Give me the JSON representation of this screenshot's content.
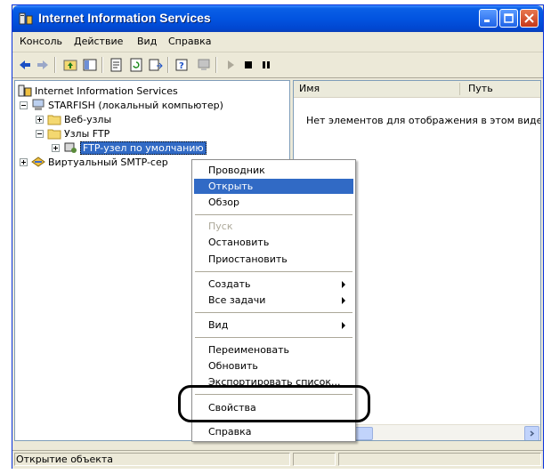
{
  "window": {
    "title": "Internet Information Services",
    "colors": {
      "titlebar": "#0254e0",
      "selection": "#316ac5",
      "close_button": "#c5371a"
    }
  },
  "menubar": {
    "items": [
      "Консоль",
      "Действие",
      "Вид",
      "Справка"
    ]
  },
  "toolbar": {
    "buttons": [
      "back-arrow-icon",
      "forward-arrow-icon",
      "up-folder-icon",
      "show-tree-icon",
      "properties-icon",
      "refresh-icon",
      "export-list-icon",
      "help-icon",
      "computer-icon",
      "play-icon",
      "stop-icon",
      "pause-icon"
    ]
  },
  "tree": {
    "root": "Internet Information Services",
    "computer": "STARFISH (локальный компьютер)",
    "websites": "Веб-узлы",
    "ftp_sites": "Узлы FTP",
    "ftp_default": "FTP-узел по умолчанию",
    "smtp": "Виртуальный SMTP-сер"
  },
  "list": {
    "columns": [
      "Имя",
      "Путь"
    ],
    "empty_message": "Нет элементов для отображения в этом виде."
  },
  "context_menu": {
    "explorer": "Проводник",
    "open": "Открыть",
    "browse": "Обзор",
    "start": "Пуск",
    "stop": "Остановить",
    "pause": "Приостановить",
    "new": "Создать",
    "all_tasks": "Все задачи",
    "view": "Вид",
    "rename": "Переименовать",
    "refresh": "Обновить",
    "export_list": "Экспортировать список...",
    "properties": "Свойства",
    "help": "Справка"
  },
  "statusbar": {
    "text": "Открытие объекта"
  }
}
